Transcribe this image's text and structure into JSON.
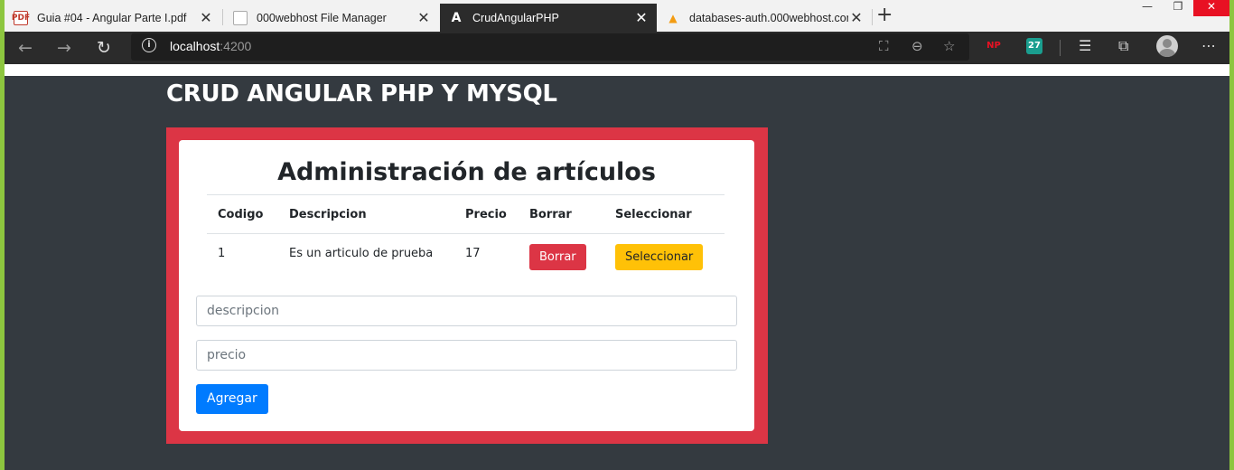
{
  "browser": {
    "tabs": [
      {
        "title": "Guia #04 - Angular Parte I.pdf",
        "favicon": "pdf-icon",
        "active": false
      },
      {
        "title": "000webhost File Manager",
        "favicon": "page-icon",
        "active": false
      },
      {
        "title": "CrudAngularPHP",
        "favicon": "angular-icon",
        "active": true
      },
      {
        "title": "databases-auth.000webhost.com",
        "favicon": "phpmyadmin-icon",
        "active": false
      }
    ],
    "address": {
      "host": "localhost",
      "port": ":4200"
    },
    "extensions": {
      "np": "NP",
      "badge": "27"
    },
    "colors": {
      "accent_frame": "#8dc63f",
      "tab_active": "#2b2b2b",
      "close_button": "#e81123"
    }
  },
  "page": {
    "title": "CRUD ANGULAR PHP Y MYSQL",
    "card_title": "Administración de artículos",
    "table": {
      "headers": [
        "Codigo",
        "Descripcion",
        "Precio",
        "Borrar",
        "Seleccionar"
      ],
      "rows": [
        {
          "codigo": "1",
          "descripcion": "Es un articulo de prueba",
          "precio": "17",
          "borrar": "Borrar",
          "seleccionar": "Seleccionar"
        }
      ]
    },
    "form": {
      "descripcion_placeholder": "descripcion",
      "precio_placeholder": "precio",
      "submit_label": "Agregar"
    },
    "colors": {
      "background": "#343a40",
      "panel": "#dc3545",
      "danger": "#dc3545",
      "warning": "#ffc107",
      "primary": "#007bff"
    }
  }
}
